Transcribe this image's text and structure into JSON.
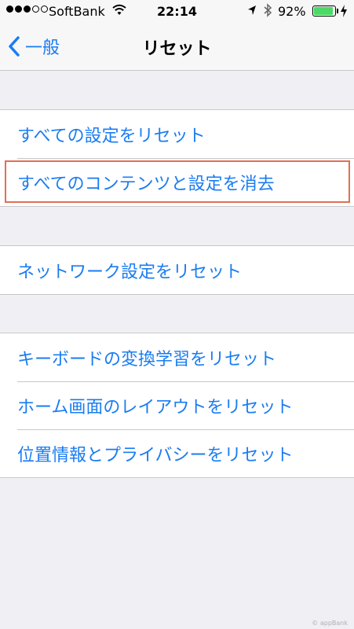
{
  "status_bar": {
    "carrier": "SoftBank",
    "time": "22:14",
    "battery_percent": "92%",
    "battery_level": 0.92
  },
  "nav": {
    "back_label": "一般",
    "title": "リセット"
  },
  "groups": [
    {
      "rows": [
        "すべての設定をリセット",
        "すべてのコンテンツと設定を消去"
      ]
    },
    {
      "rows": [
        "ネットワーク設定をリセット"
      ]
    },
    {
      "rows": [
        "キーボードの変換学習をリセット",
        "ホーム画面のレイアウトをリセット",
        "位置情報とプライバシーをリセット"
      ]
    }
  ],
  "annotation": {
    "highlighted_row": "すべてのコンテンツと設定を消去",
    "color": "#e07051"
  },
  "colors": {
    "accent": "#1a7cf2",
    "background": "#efeff4",
    "battery": "#4cd964"
  },
  "watermark": "© appBank"
}
